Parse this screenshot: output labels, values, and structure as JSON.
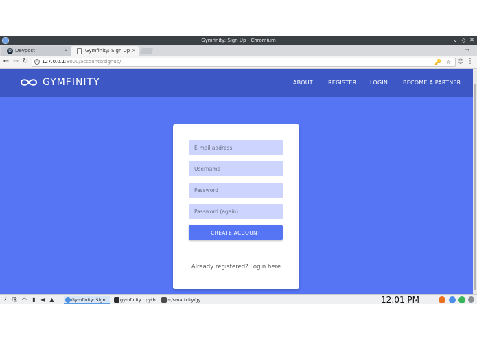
{
  "window": {
    "title": "Gymfinity: Sign Up - Chromium",
    "controls": {
      "minimize": "⌄",
      "maximize": "◇",
      "close": "✕"
    }
  },
  "tabs": [
    {
      "label": "Devpost",
      "favicon": "devpost-icon",
      "favicon_letter": "D",
      "close": "×"
    },
    {
      "label": "Gymfinity: Sign Up",
      "favicon": "page-icon",
      "close": "×"
    }
  ],
  "toolbar": {
    "back": "←",
    "forward": "→",
    "reload": "↻",
    "home": "⌂",
    "info": "i",
    "url_host": "127.0.0.1",
    "url_path": ":8000/accounts/signup/",
    "key_icon": "🔑",
    "star_icon": "☆",
    "extension_icon": "☺",
    "menu": "⋮",
    "user_icon": "▭"
  },
  "site": {
    "brand": "GYMFINITY",
    "brand_color": "#3d58c4",
    "background_color": "#5575f5",
    "nav": [
      "ABOUT",
      "REGISTER",
      "LOGIN",
      "BECOME A PARTNER"
    ]
  },
  "form": {
    "email_placeholder": "E-mail address",
    "username_placeholder": "Username",
    "password_placeholder": "Password",
    "password2_placeholder": "Password (again)",
    "submit_label": "CREATE ACCOUNT",
    "login_prompt": "Already registered? Login here"
  },
  "taskbar": {
    "tray": [
      "⚡",
      "⎘",
      "◠",
      "▮",
      "◀",
      "▲"
    ],
    "tasks": [
      {
        "label": "Gymfinity: Sign ..."
      },
      {
        "label": "gymfinity : pyth..."
      },
      {
        "label": "~/smartcity/gy..."
      }
    ],
    "clock": "12:01 PM"
  }
}
